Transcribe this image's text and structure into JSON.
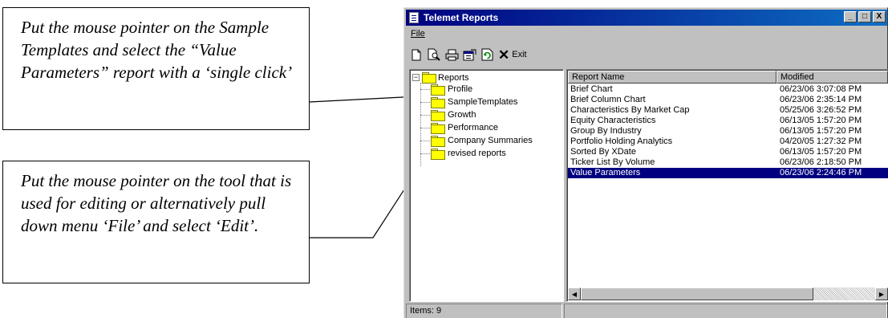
{
  "callouts": {
    "first": "Put the mouse pointer on the Sample Templates and select the “Value Parameters” report with a ‘single click’",
    "second": "Put the mouse pointer on the tool that is used for editing or alternatively pull down menu ‘File’ and select ‘Edit’."
  },
  "window": {
    "title": "Telemet Reports",
    "minimize": "_",
    "maximize": "□",
    "close": "X"
  },
  "menu": {
    "file": "File"
  },
  "toolbar": {
    "icons": [
      "new-icon",
      "print-preview-icon",
      "print-icon",
      "properties-icon",
      "refresh-icon",
      "exit-icon"
    ],
    "exit_label": "Exit",
    "exit_glyph": "✕"
  },
  "tree": {
    "root": "Reports",
    "root_expander": "−",
    "folders": [
      "Profile",
      "SampleTemplates",
      "Growth",
      "Performance",
      "Company Summaries",
      "revised reports"
    ]
  },
  "list": {
    "columns": [
      "Report Name",
      "Modified"
    ],
    "rows": [
      {
        "name": "Brief Chart",
        "modified": "06/23/06 3:07:08 PM"
      },
      {
        "name": "Brief Column Chart",
        "modified": "06/23/06 2:35:14 PM"
      },
      {
        "name": "Characteristics By Market Cap",
        "modified": "05/25/06 3:26:52 PM"
      },
      {
        "name": "Equity Characteristics",
        "modified": "06/13/05 1:57:20 PM"
      },
      {
        "name": "Group By Industry",
        "modified": "06/13/05 1:57:20 PM"
      },
      {
        "name": "Portfolio Holding Analytics",
        "modified": "04/20/05 1:27:32 PM"
      },
      {
        "name": "Sorted By XDate",
        "modified": "06/13/05 1:57:20 PM"
      },
      {
        "name": "Ticker List By Volume",
        "modified": "06/23/06 2:18:50 PM"
      },
      {
        "name": "Value Parameters",
        "modified": "06/23/06 2:24:46 PM"
      }
    ],
    "selected_row": 8
  },
  "scrollbar": {
    "left_arrow": "◀",
    "right_arrow": "▶"
  },
  "status": {
    "items": "Items: 9",
    "rest": ""
  }
}
